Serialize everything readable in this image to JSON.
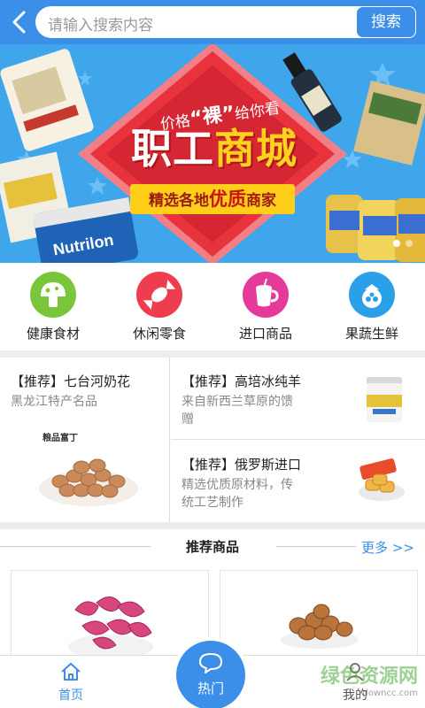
{
  "header": {
    "search_placeholder": "请输入搜索内容",
    "search_button": "搜索"
  },
  "banner": {
    "tagline_pre": "价格",
    "tagline_key": "“裸”",
    "tagline_post": "给你看",
    "title_a": "职工",
    "title_b": "商城",
    "ribbon_pre": "精选各地",
    "ribbon_key": "优质",
    "ribbon_post": "商家",
    "product_text": "Nutrilon",
    "slide_count": 2,
    "active_slide": 1
  },
  "categories": [
    {
      "label": "健康食材",
      "color": "#7ac63a",
      "icon": "mushroom-icon"
    },
    {
      "label": "休闲零食",
      "color": "#ee3d4e",
      "icon": "candy-icon"
    },
    {
      "label": "进口商品",
      "color": "#e63a9a",
      "icon": "cup-icon"
    },
    {
      "label": "果蔬生鲜",
      "color": "#2aa0e8",
      "icon": "mangosteen-icon"
    }
  ],
  "promos": {
    "left": {
      "title": "【推荐】七台河奶花",
      "subtitle": "黑龙江特产名品",
      "brand": "粮品富丁"
    },
    "right_top": {
      "title": "【推荐】高培冰纯羊",
      "subtitle_line1": "来自新西兰草原的馈",
      "subtitle_line2": "赠"
    },
    "right_bottom": {
      "title": "【推荐】俄罗斯进口",
      "subtitle_line1": "精选优质原材料，传",
      "subtitle_line2": "统工艺制作"
    }
  },
  "recommend": {
    "title": "推荐商品",
    "more": "更多 >>"
  },
  "nav": {
    "home": "首页",
    "hot": "热门",
    "mine": "我的"
  },
  "watermark": {
    "text": "绿色资源网",
    "url": "downcc.com"
  },
  "colors": {
    "primary": "#3b8fe8",
    "banner_bg": "#3fa6ec",
    "banner_red": "#e8323c",
    "ribbon": "#ffcf1a"
  }
}
